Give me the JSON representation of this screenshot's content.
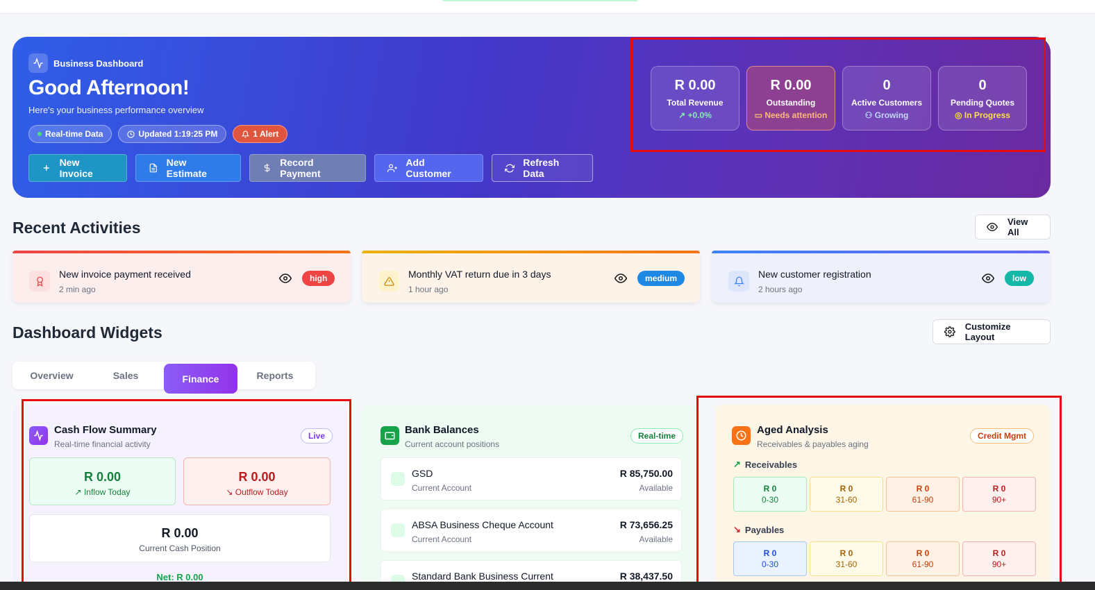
{
  "hero": {
    "tag": "Business Dashboard",
    "greeting": "Good Afternoon!",
    "subtitle": "Here's your business performance overview",
    "badges": {
      "realtime": "Real-time Data",
      "updated": "Updated 1:19:25 PM",
      "alert": "1 Alert"
    },
    "actions": {
      "new_invoice": "New Invoice",
      "new_estimate": "New Estimate",
      "record_payment": "Record Payment",
      "add_customer": "Add Customer",
      "refresh": "Refresh Data"
    },
    "stats": [
      {
        "value": "R 0.00",
        "label": "Total Revenue",
        "sub": "+0.0%"
      },
      {
        "value": "R 0.00",
        "label": "Outstanding",
        "sub": "Needs attention"
      },
      {
        "value": "0",
        "label": "Active Customers",
        "sub": "Growing"
      },
      {
        "value": "0",
        "label": "Pending Quotes",
        "sub": "In Progress"
      }
    ]
  },
  "activities": {
    "title": "Recent Activities",
    "view_all": "View All",
    "items": [
      {
        "text": "New invoice payment received",
        "time": "2 min ago",
        "priority": "high"
      },
      {
        "text": "Monthly VAT return due in 3 days",
        "time": "1 hour ago",
        "priority": "medium"
      },
      {
        "text": "New customer registration",
        "time": "2 hours ago",
        "priority": "low"
      }
    ]
  },
  "widgets": {
    "title": "Dashboard Widgets",
    "customize": "Customize Layout",
    "tabs": [
      "Overview",
      "Sales",
      "Finance",
      "Reports"
    ],
    "active_tab": "Finance"
  },
  "cashflow": {
    "title": "Cash Flow Summary",
    "subtitle": "Real-time financial activity",
    "tag": "Live",
    "inflow_value": "R 0.00",
    "inflow_label": "Inflow Today",
    "outflow_value": "R 0.00",
    "outflow_label": "Outflow Today",
    "position_value": "R 0.00",
    "position_label": "Current Cash Position",
    "net": "Net: R 0.00"
  },
  "bank": {
    "title": "Bank Balances",
    "subtitle": "Current account positions",
    "tag": "Real-time",
    "accounts": [
      {
        "name": "GSD",
        "type": "Current Account",
        "amount": "R 85,750.00",
        "status": "Available"
      },
      {
        "name": "ABSA Business Cheque Account",
        "type": "Current Account",
        "amount": "R 73,656.25",
        "status": "Available"
      },
      {
        "name": "Standard Bank Business Current",
        "type": "",
        "amount": "R 38,437.50",
        "status": ""
      }
    ]
  },
  "aged": {
    "title": "Aged Analysis",
    "subtitle": "Receivables & payables aging",
    "tag": "Credit Mgmt",
    "receivables_label": "Receivables",
    "payables_label": "Payables",
    "receivables": [
      {
        "value": "R 0",
        "range": "0-30"
      },
      {
        "value": "R 0",
        "range": "31-60"
      },
      {
        "value": "R 0",
        "range": "61-90"
      },
      {
        "value": "R 0",
        "range": "90+"
      }
    ],
    "payables": [
      {
        "value": "R 0",
        "range": "0-30"
      },
      {
        "value": "R 0",
        "range": "31-60"
      },
      {
        "value": "R 0",
        "range": "61-90"
      },
      {
        "value": "R 0",
        "range": "90+"
      }
    ]
  },
  "colors": {
    "accent": "#8b5cf6",
    "highlight_border": "#e80b0b",
    "priority_high": "#ef4444",
    "priority_medium": "#1e88e5",
    "priority_low": "#14b8a6"
  }
}
